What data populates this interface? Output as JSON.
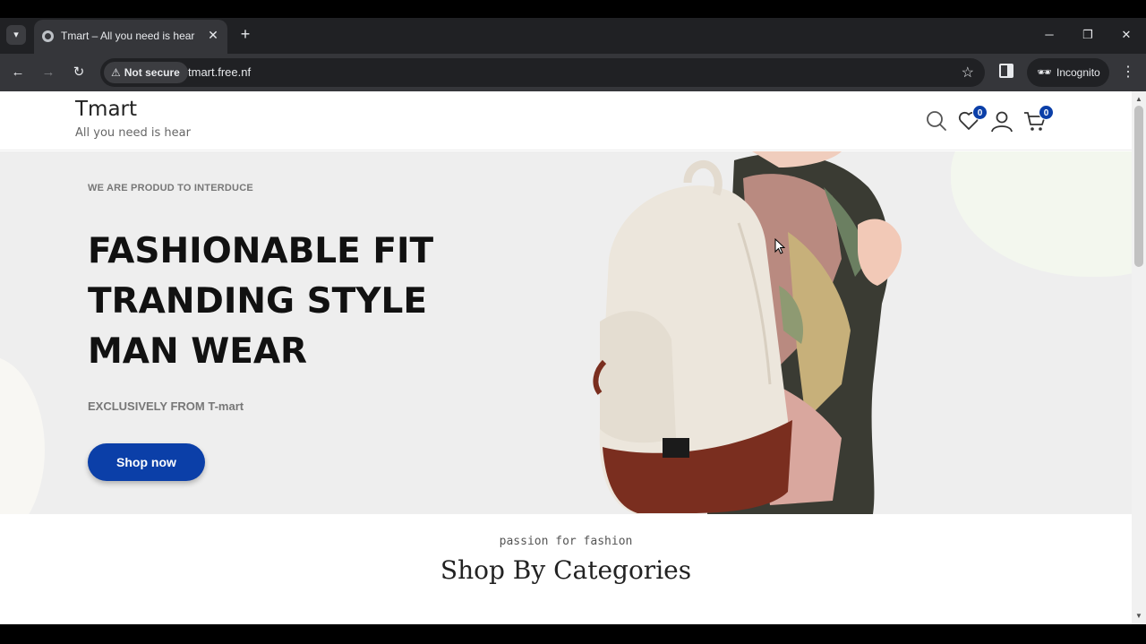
{
  "browser": {
    "tab": {
      "title": "Tmart – All you need is hear"
    },
    "security_label": "Not secure",
    "url": "tmart.free.nf",
    "incognito_label": "Incognito"
  },
  "site": {
    "logo": "Tmart",
    "tagline": "All you need is hear",
    "wishlist_count": "0",
    "cart_count": "0"
  },
  "hero": {
    "eyebrow": "WE ARE PRODUD TO INTERDUCE",
    "headline_line1": "FASHIONABLE FIT",
    "headline_line2": "TRANDING STYLE",
    "headline_line3": "MAN WEAR",
    "subline": "EXCLUSIVELY FROM T-mart",
    "cta_label": "Shop now"
  },
  "section": {
    "kicker": "passion for fashion",
    "title": "Shop By Categories"
  },
  "colors": {
    "brand": "#0b3fa8",
    "hero_bg": "#eeeeee",
    "chrome_dark": "#202124"
  }
}
